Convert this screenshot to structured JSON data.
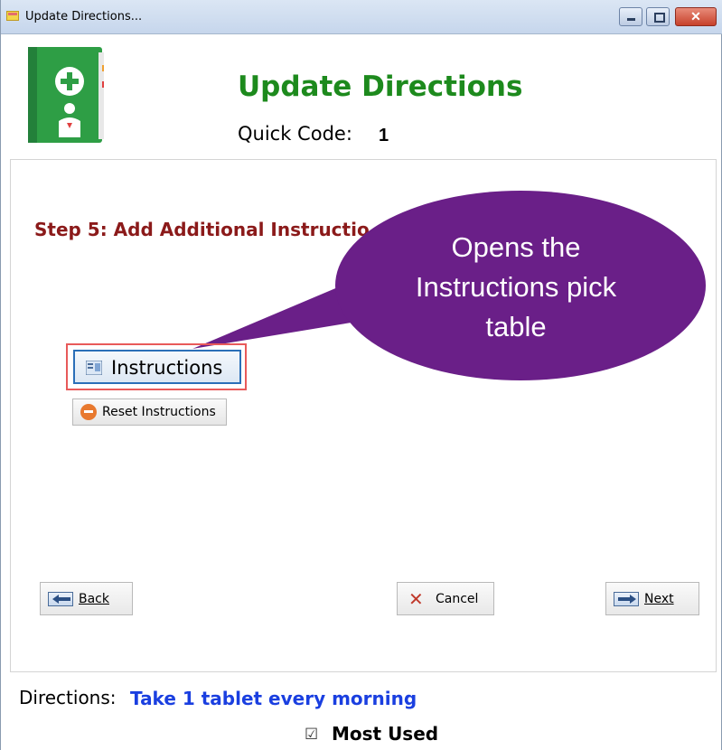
{
  "window": {
    "title": "Update Directions...",
    "minimize_icon": "minimize-icon",
    "maximize_icon": "maximize-icon",
    "close_icon": "close-icon",
    "close_glyph": "✕"
  },
  "header": {
    "title": "Update Directions",
    "quick_code_label": "Quick Code:",
    "quick_code_value": "1",
    "logo_icon": "medical-book-icon"
  },
  "step": {
    "label": "Step 5: Add Additional Instructio"
  },
  "callout": {
    "lines": [
      "Opens the",
      "Instructions pick",
      "table"
    ],
    "color": "#6a1f88"
  },
  "buttons": {
    "instructions": "Instructions",
    "reset_instructions": "Reset Instructions",
    "back": "Back",
    "cancel": "Cancel",
    "next": "Next",
    "cancel_glyph": "✕"
  },
  "footer": {
    "directions_label": "Directions:",
    "directions_value": "Take 1 tablet every morning",
    "most_used_label": "Most Used",
    "most_used_checked": true,
    "checkbox_glyph": "☑"
  },
  "colors": {
    "heading_green": "#1d8a1d",
    "step_red": "#8b1a1a",
    "directions_blue": "#1a3fe0",
    "highlight_red": "#e85a5a"
  }
}
